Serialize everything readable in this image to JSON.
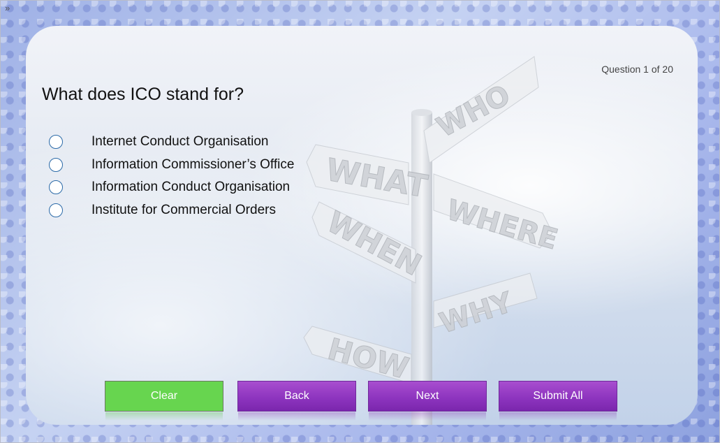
{
  "nav": {
    "toggle_icon": "»"
  },
  "quiz": {
    "counter": "Question 1 of 20",
    "question": "What does ICO stand for?",
    "options": [
      {
        "label": "Internet Conduct Organisation",
        "selected": false
      },
      {
        "label": "Information Commissioner’s Office",
        "selected": false
      },
      {
        "label": "Information Conduct Organisation",
        "selected": false
      },
      {
        "label": "Institute for Commercial Orders",
        "selected": false
      }
    ]
  },
  "signs": {
    "who": "WHO",
    "what": "WHAT",
    "where": "WHERE",
    "when": "WHEN",
    "why": "WHY",
    "how": "HOW"
  },
  "buttons": {
    "clear": "Clear",
    "back": "Back",
    "next": "Next",
    "submit": "Submit All"
  },
  "colors": {
    "clear_button": "#67d54f",
    "nav_buttons": "#8e35bf",
    "radio_border": "#2b6aa8"
  }
}
